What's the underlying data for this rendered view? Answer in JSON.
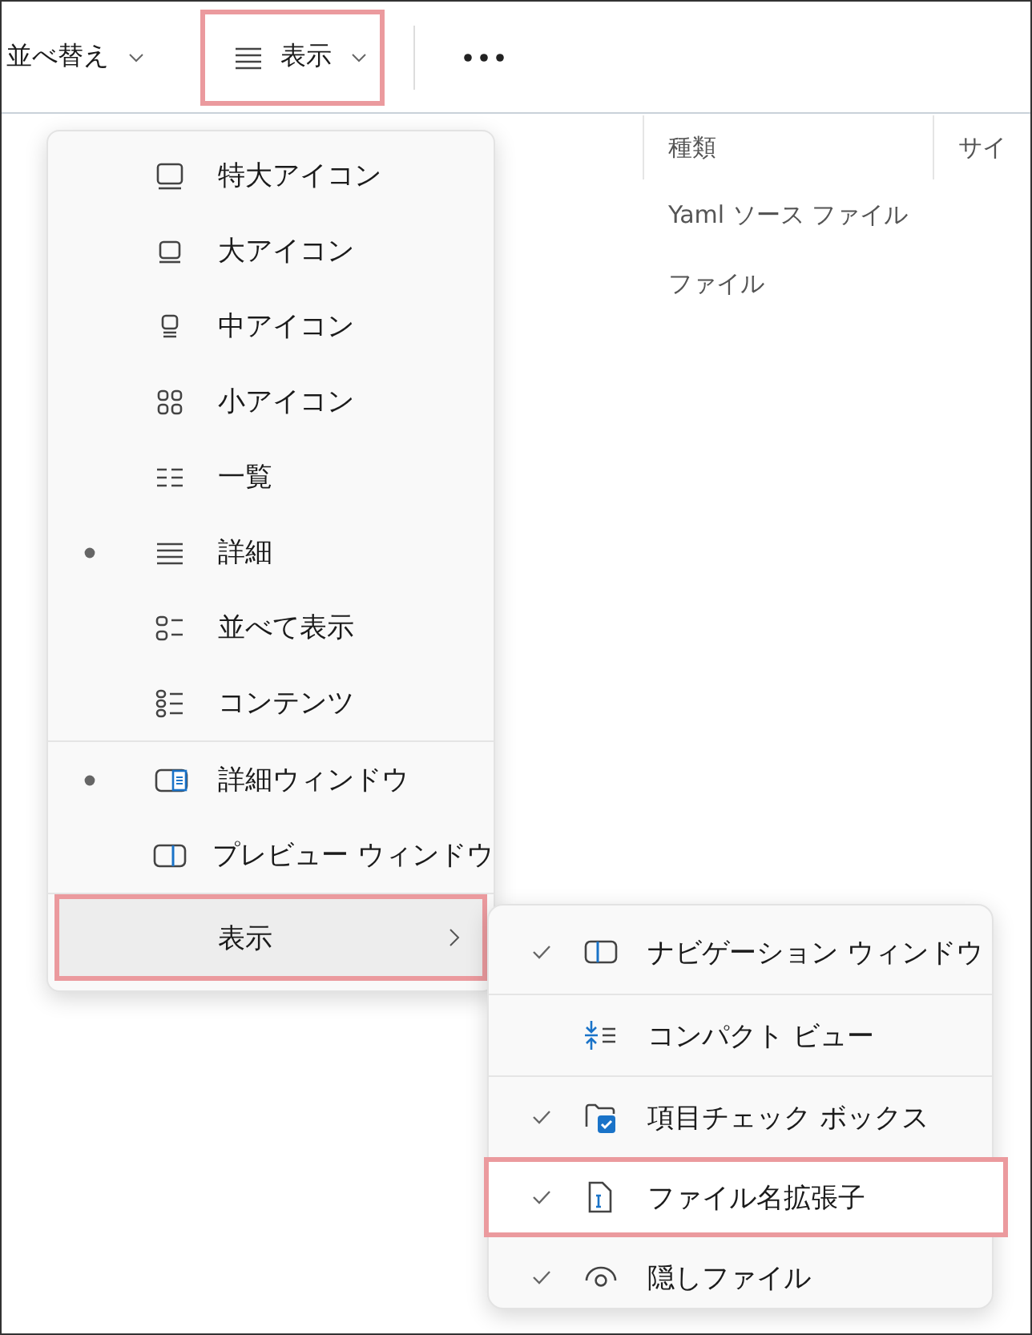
{
  "toolbar": {
    "items": [
      {
        "kind": "sort",
        "label": "並べ替え",
        "highlighted": false
      },
      {
        "kind": "view",
        "label": "表示",
        "highlighted": true
      },
      {
        "kind": "more"
      }
    ]
  },
  "file_list": {
    "columns": [
      "種類",
      "サイ"
    ],
    "rows": [
      {
        "cells": [
          "Yaml ソース ファイル"
        ]
      },
      {
        "cells": [
          "ファイル"
        ]
      }
    ]
  },
  "view_menu": {
    "groups": [
      [
        {
          "label": "特大アイコン",
          "kind": "xl",
          "selected": false
        },
        {
          "label": "大アイコン",
          "kind": "large",
          "selected": false
        },
        {
          "label": "中アイコン",
          "kind": "medium",
          "selected": false
        },
        {
          "label": "小アイコン",
          "kind": "small",
          "selected": false
        },
        {
          "label": "一覧",
          "kind": "list",
          "selected": false
        },
        {
          "label": "詳細",
          "kind": "details",
          "selected": true
        },
        {
          "label": "並べて表示",
          "kind": "tiles",
          "selected": false
        },
        {
          "label": "コンテンツ",
          "kind": "content",
          "selected": false
        }
      ],
      [
        {
          "label": "詳細ウィンドウ",
          "kind": "detailspane",
          "selected": true
        },
        {
          "label": "プレビュー ウィンドウ",
          "kind": "previewpane",
          "selected": false
        }
      ]
    ],
    "submenu_trigger": {
      "label": "表示",
      "highlighted": true
    }
  },
  "show_submenu": {
    "groups": [
      [
        {
          "label": "ナビゲーション ウィンドウ",
          "kind": "navpane",
          "checked": true,
          "highlighted": false
        }
      ],
      [
        {
          "label": "コンパクト ビュー",
          "kind": "compact",
          "checked": false,
          "highlighted": false
        }
      ],
      [
        {
          "label": "項目チェック ボックス",
          "kind": "checkbox",
          "checked": true,
          "highlighted": false
        },
        {
          "label": "ファイル名拡張子",
          "kind": "extension",
          "checked": true,
          "highlighted": true
        },
        {
          "label": "隠しファイル",
          "kind": "hidden",
          "checked": true,
          "highlighted": false
        }
      ]
    ]
  }
}
